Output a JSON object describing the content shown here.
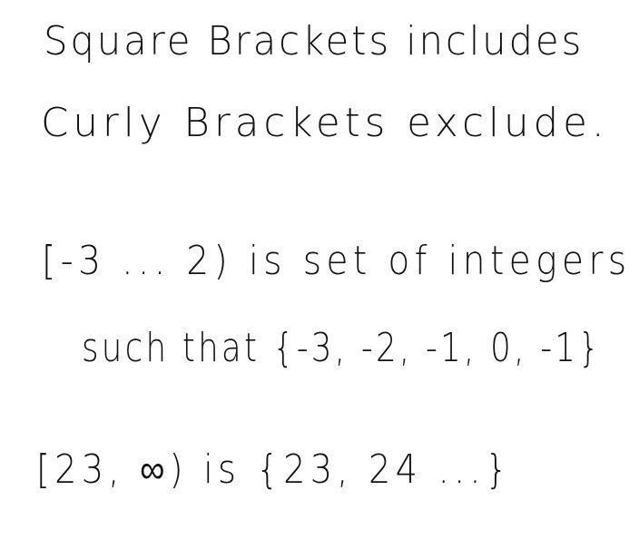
{
  "notes": {
    "lines": [
      "Square Brackets includes",
      "Curly Brackets exclude.",
      "[-3 ... 2) is set of integers",
      "such that {-3, -2, -1, 0, -1}",
      "[23, ∞) is {23, 24 ...}"
    ]
  }
}
